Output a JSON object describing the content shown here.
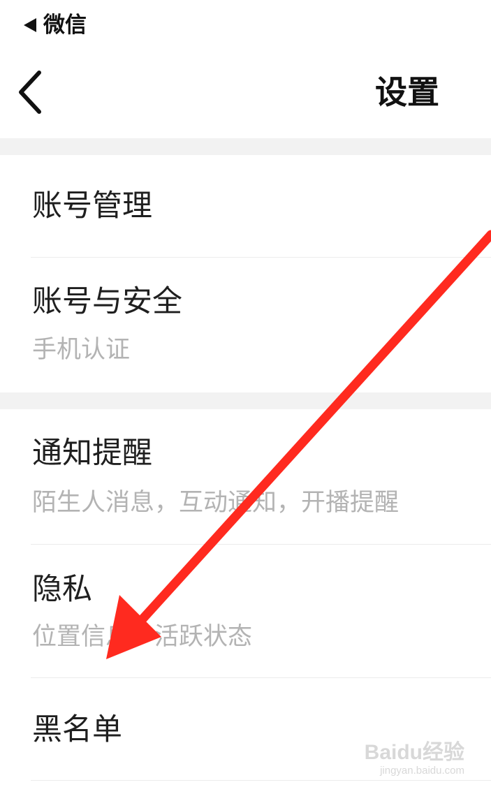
{
  "status_bar": {
    "back_app_label": "微信"
  },
  "nav": {
    "title": "设置"
  },
  "settings": {
    "account_management": {
      "title": "账号管理"
    },
    "account_security": {
      "title": "账号与安全",
      "subtitle": "手机认证"
    },
    "notifications": {
      "title": "通知提醒",
      "subtitle": "陌生人消息，互动通知，开播提醒"
    },
    "privacy": {
      "title": "隐私",
      "subtitle": "位置信息，活跃状态"
    },
    "blacklist": {
      "title": "黑名单"
    }
  },
  "watermark": {
    "brand": "Baidu经验",
    "url": "jingyan.baidu.com"
  },
  "colors": {
    "annotation_arrow": "#ff2a1f",
    "section_gap": "#f2f2f2",
    "subtitle_text": "#b3b3b3"
  }
}
